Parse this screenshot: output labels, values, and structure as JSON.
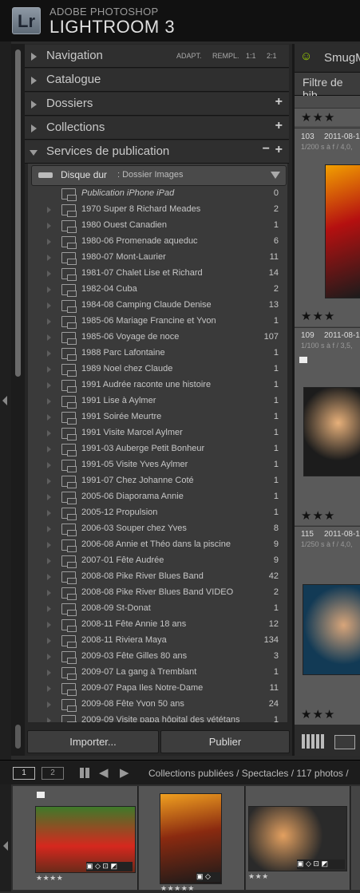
{
  "app": {
    "badge": "Lr",
    "brand_line1": "ADOBE PHOTOSHOP",
    "brand_line2": "LIGHTROOM 3"
  },
  "panels": {
    "navigation": {
      "label": "Navigation",
      "options": [
        "ADAPT.",
        "REMPL.",
        "1:1",
        "2:1"
      ]
    },
    "catalogue": {
      "label": "Catalogue"
    },
    "dossiers": {
      "label": "Dossiers"
    },
    "collections": {
      "label": "Collections"
    },
    "publish": {
      "label": "Services de publication"
    }
  },
  "publish_service": {
    "name": "Disque dur",
    "subtitle": ": Dossier Images"
  },
  "publish_items": [
    {
      "name": "Publication iPhone iPad",
      "count": "0"
    },
    {
      "name": "1970 Super 8 Richard Meades",
      "count": "2"
    },
    {
      "name": "1980 Ouest Canadien",
      "count": "1"
    },
    {
      "name": "1980-06 Promenade aqueduc",
      "count": "6"
    },
    {
      "name": "1980-07 Mont-Laurier",
      "count": "11"
    },
    {
      "name": "1981-07 Chalet Lise et Richard",
      "count": "14"
    },
    {
      "name": "1982-04 Cuba",
      "count": "2"
    },
    {
      "name": "1984-08 Camping Claude Denise",
      "count": "13"
    },
    {
      "name": "1985-06 Mariage Francine et Yvon",
      "count": "1"
    },
    {
      "name": "1985-06 Voyage de noce",
      "count": "107"
    },
    {
      "name": "1988 Parc Lafontaine",
      "count": "1"
    },
    {
      "name": "1989 Noel chez Claude",
      "count": "1"
    },
    {
      "name": "1991 Audrée raconte une histoire",
      "count": "1"
    },
    {
      "name": "1991 Lise à Aylmer",
      "count": "1"
    },
    {
      "name": "1991 Soirée Meurtre",
      "count": "1"
    },
    {
      "name": "1991 Visite Marcel Aylmer",
      "count": "1"
    },
    {
      "name": "1991-03 Auberge Petit Bonheur",
      "count": "1"
    },
    {
      "name": "1991-05 Visite Yves Aylmer",
      "count": "1"
    },
    {
      "name": "1991-07 Chez Johanne Coté",
      "count": "1"
    },
    {
      "name": "2005-06 Diaporama Annie",
      "count": "1"
    },
    {
      "name": "2005-12 Propulsion",
      "count": "1"
    },
    {
      "name": "2006-03 Souper chez Yves",
      "count": "8"
    },
    {
      "name": "2006-08 Annie et Théo dans la piscine",
      "count": "9"
    },
    {
      "name": "2007-01 Fête Audrée",
      "count": "9"
    },
    {
      "name": "2008-08 Pike River Blues Band",
      "count": "42"
    },
    {
      "name": "2008-08 Pike River Blues Band VIDEO",
      "count": "2"
    },
    {
      "name": "2008-09 St-Donat",
      "count": "1"
    },
    {
      "name": "2008-11 Fête Annie 18 ans",
      "count": "12"
    },
    {
      "name": "2008-11 Riviera Maya",
      "count": "134"
    },
    {
      "name": "2009-03 Fête Gilles 80 ans",
      "count": "3"
    },
    {
      "name": "2009-07 La gang à Tremblant",
      "count": "1"
    },
    {
      "name": "2009-07 Papa Iles Notre-Dame",
      "count": "11"
    },
    {
      "name": "2009-08 Fête Yvon 50 ans",
      "count": "24"
    },
    {
      "name": "2009-09 Visite papa hôpital des vététans",
      "count": "1"
    }
  ],
  "buttons": {
    "import": "Importer...",
    "publish": "Publier"
  },
  "right": {
    "service_name": "SmugM",
    "filter_label": "Filtre de bib",
    "cells": [
      {
        "stars": "★★★",
        "num": "103",
        "date": "2011-08-1",
        "meta": "1/200 s à f / 4,0,"
      },
      {
        "stars": "★★★",
        "num": "109",
        "date": "2011-08-1",
        "meta": "1/100 s à f / 3,5,"
      },
      {
        "stars": "★★★",
        "num": "115",
        "date": "2011-08-1",
        "meta": "1/250 s à f / 4,0,"
      },
      {
        "stars": "★★★"
      }
    ]
  },
  "filmstrip": {
    "monitor1": "1",
    "monitor2": "2",
    "breadcrumb": "Collections publiées / Spectacles / 117 photos /",
    "thumbs": [
      {
        "stars": "★★★★"
      },
      {
        "stars": "★★★★★"
      },
      {
        "stars": "★★★"
      }
    ]
  }
}
